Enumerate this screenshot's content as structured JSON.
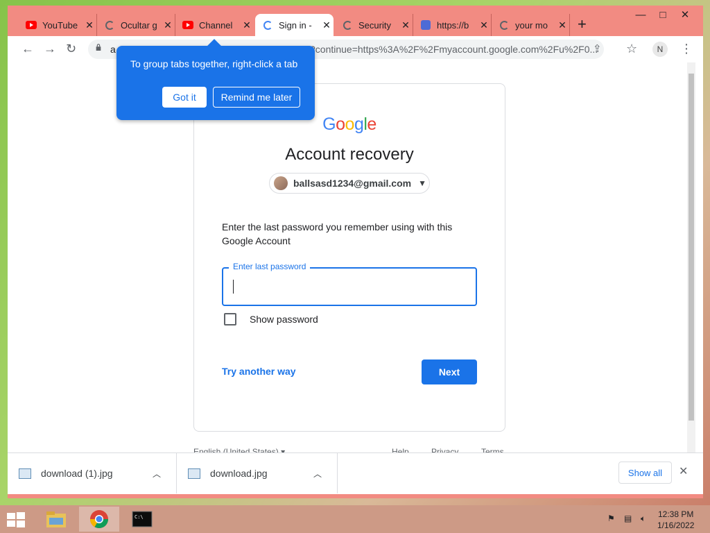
{
  "browser": {
    "tabs": [
      {
        "title": "YouTube",
        "icon": "youtube-icon"
      },
      {
        "title": "Ocultar g",
        "icon": "google-icon"
      },
      {
        "title": "Channel",
        "icon": "youtube-icon"
      },
      {
        "title": "Sign in -",
        "icon": "google-icon",
        "active": true
      },
      {
        "title": "Security",
        "icon": "google-icon"
      },
      {
        "title": "https://b",
        "icon": "bookmark-icon"
      },
      {
        "title": "your mo",
        "icon": "google-icon"
      }
    ],
    "new_tab": "+",
    "window_controls": {
      "minimize": "—",
      "maximize": "□",
      "close": "✕"
    },
    "address_prefix": "a",
    "url": "?continue=https%3A%2F%2Fmyaccount.google.com%2Fu%2F0...",
    "profile_initial": "N"
  },
  "popover": {
    "text": "To group tabs together, right-click a tab",
    "got_it": "Got it",
    "remind_later": "Remind me later"
  },
  "page": {
    "logo": "Google",
    "heading": "Account recovery",
    "email": "ballsasd1234@gmail.com",
    "instruction": "Enter the last password you remember using with this Google Account",
    "field_label": "Enter last password",
    "field_value": "",
    "show_password": "Show password",
    "try_another": "Try another way",
    "next": "Next",
    "footer": {
      "language": "English (United States)",
      "help": "Help",
      "privacy": "Privacy",
      "terms": "Terms"
    }
  },
  "downloads": {
    "items": [
      {
        "name": "download (1).jpg"
      },
      {
        "name": "download.jpg"
      }
    ],
    "show_all": "Show all"
  },
  "taskbar": {
    "time": "12:38 PM",
    "date": "1/16/2022",
    "apps": [
      "file-explorer-icon",
      "chrome-icon",
      "terminal-icon"
    ]
  },
  "colors": {
    "accent": "#1a73e8",
    "frame": "#f28b82",
    "taskbar": "#cd9a86"
  }
}
